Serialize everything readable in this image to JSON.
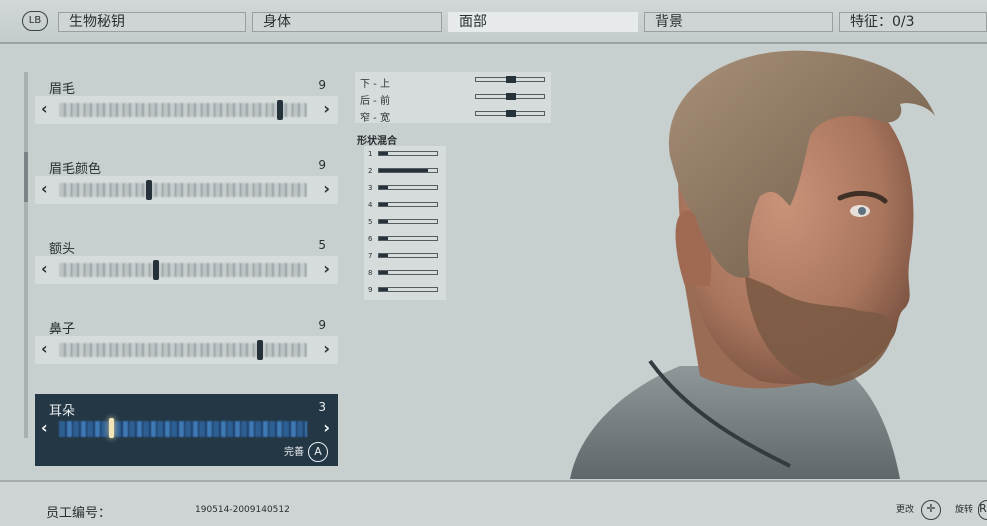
{
  "topbar": {
    "lb_label": "LB",
    "tabs": [
      {
        "label": "生物秘钥",
        "active": false
      },
      {
        "label": "身体",
        "active": false
      },
      {
        "label": "面部",
        "active": true
      },
      {
        "label": "背景",
        "active": false
      },
      {
        "label": "特征：0/3",
        "active": false
      }
    ]
  },
  "sliders": [
    {
      "label": "眉毛",
      "value": "9",
      "position": 0.88
    },
    {
      "label": "眉毛颜色",
      "value": "9",
      "position": 0.35
    },
    {
      "label": "额头",
      "value": "5",
      "position": 0.38
    },
    {
      "label": "鼻子",
      "value": "9",
      "position": 0.8
    },
    {
      "label": "耳朵",
      "value": "3",
      "position": 0.2,
      "selected": true
    }
  ],
  "selected_action": {
    "label": "完善",
    "button": "A"
  },
  "adjust_rows": [
    {
      "label": "下 - 上",
      "position": 0.5
    },
    {
      "label": "后 - 前",
      "position": 0.5
    },
    {
      "label": "窄 - 宽",
      "position": 0.5
    }
  ],
  "blend": {
    "title": "形状混合",
    "rows": [
      {
        "label": "1",
        "fill": 0.15
      },
      {
        "label": "2",
        "fill": 0.85
      },
      {
        "label": "3",
        "fill": 0.15
      },
      {
        "label": "4",
        "fill": 0.15
      },
      {
        "label": "5",
        "fill": 0.15
      },
      {
        "label": "6",
        "fill": 0.15
      },
      {
        "label": "7",
        "fill": 0.15
      },
      {
        "label": "8",
        "fill": 0.15
      },
      {
        "label": "9",
        "fill": 0.15
      }
    ]
  },
  "bottom": {
    "employee_label": "员工编号：",
    "employee_id": "190514-2009140512",
    "hints": [
      {
        "label": "更改",
        "icon": "dpad-icon",
        "glyph": "✛"
      },
      {
        "label": "旋转",
        "icon": "right-stick-icon",
        "glyph": "R"
      }
    ]
  },
  "colors": {
    "selected_bg": "#243745",
    "thumb": "#26323a",
    "accent": "#f2e6b8"
  }
}
